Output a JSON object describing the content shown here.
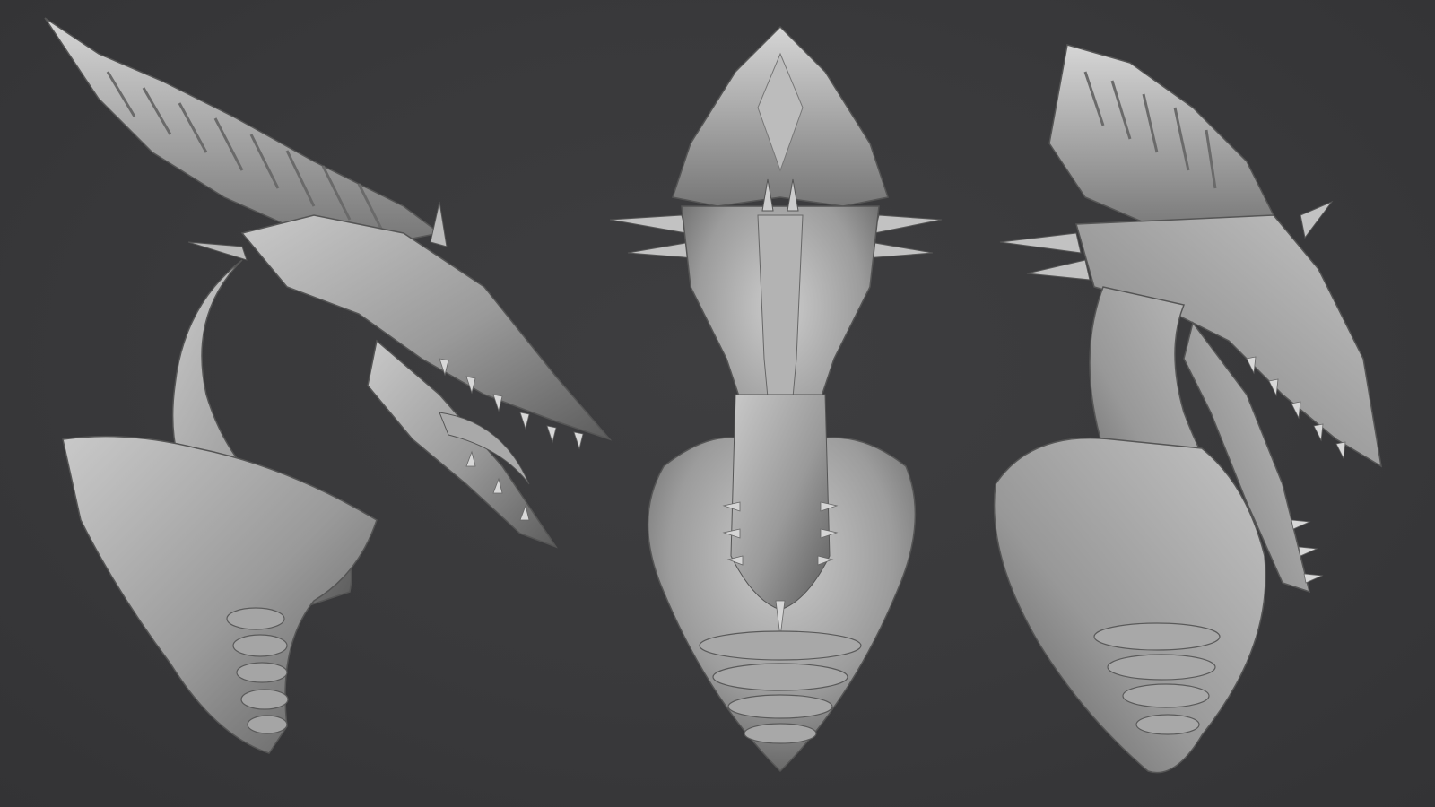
{
  "scene": {
    "background_color": "#39393b",
    "material_light": "#bdbdbd",
    "material_mid": "#8e8e8e",
    "material_dark": "#4a4a4a",
    "views": [
      {
        "name": "side-view",
        "subject": "dragon-bust"
      },
      {
        "name": "front-view",
        "subject": "dragon-bust"
      },
      {
        "name": "three-quarter-view",
        "subject": "dragon-bust"
      }
    ]
  }
}
